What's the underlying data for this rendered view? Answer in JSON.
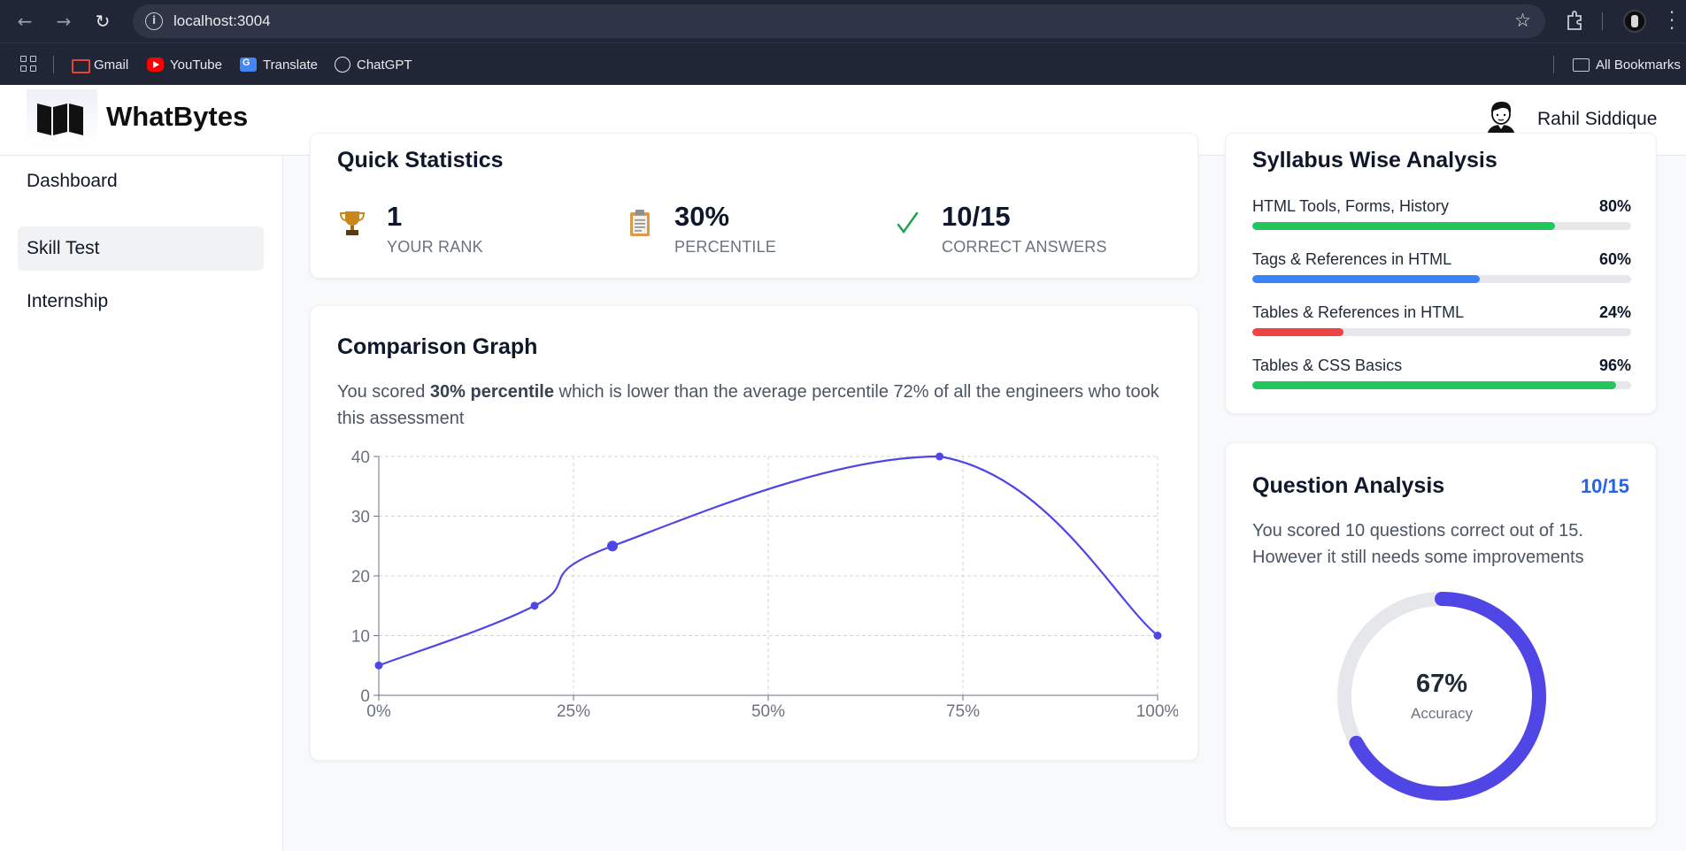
{
  "browser": {
    "url": "localhost:3004",
    "bookmarks": [
      "Gmail",
      "YouTube",
      "Translate",
      "ChatGPT"
    ],
    "all_bookmarks_label": "All Bookmarks"
  },
  "header": {
    "brand": "WhatBytes",
    "user_name": "Rahil Siddique"
  },
  "sidebar": {
    "items": [
      {
        "label": "Dashboard",
        "active": false
      },
      {
        "label": "Skill Test",
        "active": true
      },
      {
        "label": "Internship",
        "active": false
      }
    ]
  },
  "quick_stats": {
    "title": "Quick Statistics",
    "items": [
      {
        "icon": "trophy-icon",
        "value": "1",
        "label": "YOUR RANK"
      },
      {
        "icon": "clipboard-icon",
        "value": "30%",
        "label": "PERCENTILE"
      },
      {
        "icon": "check-icon",
        "value": "10/15",
        "label": "CORRECT ANSWERS"
      }
    ]
  },
  "comparison": {
    "title": "Comparison Graph",
    "desc_before": "You scored ",
    "desc_bold": "30% percentile",
    "desc_after": " which is lower than the average percentile 72% of all the engineers who took this assessment"
  },
  "chart_data": {
    "type": "line",
    "title": "",
    "xlabel": "",
    "ylabel": "",
    "x_ticks": [
      "0%",
      "25%",
      "50%",
      "75%",
      "100%"
    ],
    "y_ticks": [
      "0",
      "10",
      "20",
      "30",
      "40"
    ],
    "xlim": [
      0,
      100
    ],
    "ylim": [
      0,
      40
    ],
    "grid": true,
    "series": [
      {
        "color": "#4f46e5",
        "points": [
          {
            "x": 0,
            "y": 5
          },
          {
            "x": 20,
            "y": 15
          },
          {
            "x": 30,
            "y": 25
          },
          {
            "x": 72,
            "y": 40
          },
          {
            "x": 100,
            "y": 10
          }
        ]
      }
    ]
  },
  "syllabus": {
    "title": "Syllabus Wise Analysis",
    "items": [
      {
        "label": "HTML Tools, Forms, History",
        "percent": "80%",
        "value": 80,
        "color": "#22c55e"
      },
      {
        "label": "Tags & References in HTML",
        "percent": "60%",
        "value": 60,
        "color": "#3b82f6"
      },
      {
        "label": "Tables & References in HTML",
        "percent": "24%",
        "value": 24,
        "color": "#ef4444"
      },
      {
        "label": "Tables & CSS Basics",
        "percent": "96%",
        "value": 96,
        "color": "#22c55e"
      }
    ]
  },
  "question_analysis": {
    "title": "Question Analysis",
    "score": "10/15",
    "desc": "You scored 10 questions correct out of 15. However it still needs some improvements",
    "accuracy_label": "67%",
    "accuracy_value": 67,
    "accuracy_caption": "Accuracy",
    "ring_color": "#4f46e5",
    "track_color": "#e5e7eb"
  }
}
